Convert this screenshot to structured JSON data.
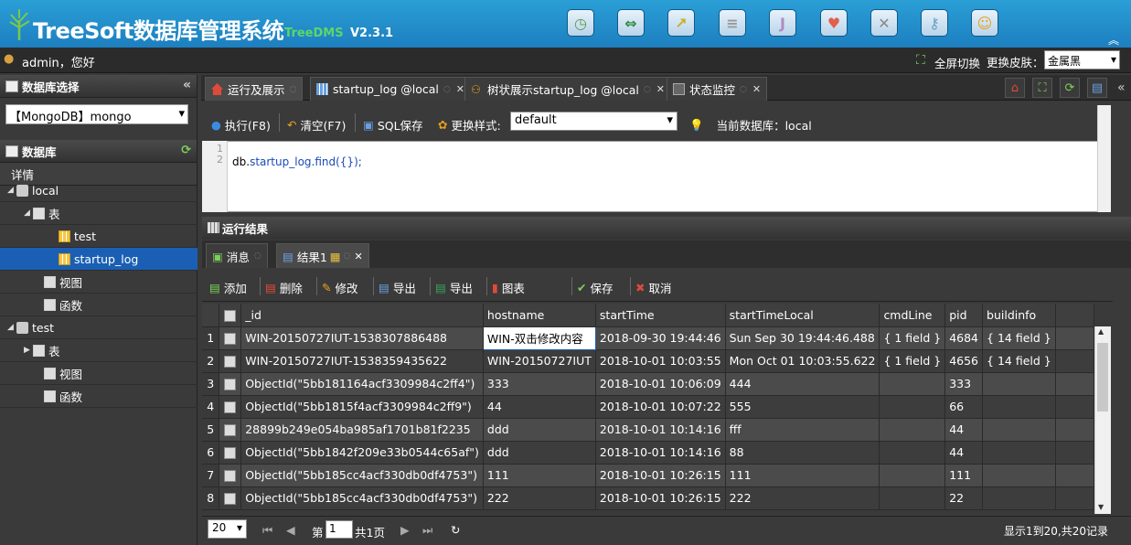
{
  "header": {
    "title": "TreeSoft数据库管理系统",
    "subtitle": "TreeDMS",
    "version": "V2.3.1",
    "toolbar_icons": [
      {
        "name": "clock-icon",
        "glyph": "◷",
        "color": "#5a9a4a"
      },
      {
        "name": "arrows-icon",
        "glyph": "⇔",
        "color": "#2d8a3c"
      },
      {
        "name": "chart-icon",
        "glyph": "↗",
        "color": "#c8b020"
      },
      {
        "name": "database-icon",
        "glyph": "≡",
        "color": "#999999"
      },
      {
        "name": "letter-j-icon",
        "glyph": "J",
        "color": "#b08ac0"
      },
      {
        "name": "heart-icon",
        "glyph": "♥",
        "color": "#e0604a"
      },
      {
        "name": "tools-icon",
        "glyph": "✕",
        "color": "#888888"
      },
      {
        "name": "key-icon",
        "glyph": "⚷",
        "color": "#6aa0c0"
      },
      {
        "name": "person-icon",
        "glyph": "☺",
        "color": "#e8a020"
      }
    ]
  },
  "userbar": {
    "greeting": "admin，您好",
    "fullscreen": "全屏切换",
    "skin_label": "更换皮肤：",
    "skin_value": "金属黑"
  },
  "sidebar": {
    "db_select_title": "数据库选择",
    "db_select_value": "【MongoDB】mongo",
    "db_title": "数据库",
    "detail_label": "详情",
    "tree": [
      {
        "label": "local",
        "arrow": "◢",
        "icon": "db",
        "indent": 8
      },
      {
        "label": "表",
        "arrow": "◢",
        "icon": "table",
        "indent": 26
      },
      {
        "label": "test",
        "arrow": "",
        "icon": "grid",
        "indent": 54
      },
      {
        "label": "startup_log",
        "arrow": "",
        "icon": "grid",
        "indent": 54,
        "selected": true
      },
      {
        "label": "视图",
        "arrow": "",
        "icon": "table",
        "indent": 38
      },
      {
        "label": "函数",
        "arrow": "",
        "icon": "table",
        "indent": 38
      },
      {
        "label": "test",
        "arrow": "◢",
        "icon": "db",
        "indent": 8
      },
      {
        "label": "表",
        "arrow": "▶",
        "icon": "table",
        "indent": 26
      },
      {
        "label": "视图",
        "arrow": "",
        "icon": "table",
        "indent": 38
      },
      {
        "label": "函数",
        "arrow": "",
        "icon": "table",
        "indent": 38
      }
    ]
  },
  "tabs": [
    {
      "label": "运行及展示",
      "icon": "home-icon"
    },
    {
      "label": "startup_log @local",
      "icon": "grid-icon"
    },
    {
      "label": "树状展示startup_log @local",
      "icon": "tree-icon"
    },
    {
      "label": "状态监控",
      "icon": "monitor-icon"
    }
  ],
  "sql_toolbar": {
    "execute": "执行(F8)",
    "clear": "清空(F7)",
    "save_sql": "SQL保存",
    "style_label": "更换样式:",
    "style_value": "default",
    "current_db": "当前数据库：local"
  },
  "editor": {
    "line_numbers": [
      "1",
      "2"
    ],
    "code_db": "db.",
    "code_rest": "startup_log.find({});"
  },
  "results": {
    "title": "运行结果",
    "tabs": [
      "消息",
      "结果1"
    ],
    "actions": [
      "添加",
      "删除",
      "修改",
      "导出",
      "导出",
      "图表",
      "保存",
      "取消"
    ],
    "columns": [
      "_id",
      "hostname",
      "startTime",
      "startTimeLocal",
      "cmdLine",
      "pid",
      "buildinfo"
    ],
    "rows": [
      [
        "WIN-20150727IUT-1538307886488",
        "WIN-双击修改内容",
        "2018-09-30 19:44:46",
        "Sun Sep 30 19:44:46.488",
        "{ 1 field }",
        "4684",
        "{ 14 field }"
      ],
      [
        "WIN-20150727IUT-1538359435622",
        "WIN-20150727IUT",
        "2018-10-01 10:03:55",
        "Mon Oct 01 10:03:55.622",
        "{ 1 field }",
        "4656",
        "{ 14 field }"
      ],
      [
        "ObjectId(\"5bb181164acf3309984c2ff4\")",
        "333",
        "2018-10-01 10:06:09",
        "444",
        "",
        "333",
        ""
      ],
      [
        "ObjectId(\"5bb1815f4acf3309984c2ff9\")",
        "44",
        "2018-10-01 10:07:22",
        "555",
        "",
        "66",
        ""
      ],
      [
        "28899b249e054ba985af1701b81f2235",
        "ddd",
        "2018-10-01 10:14:16",
        "fff",
        "",
        "44",
        ""
      ],
      [
        "ObjectId(\"5bb1842f209e33b0544c65af\")",
        "ddd",
        "2018-10-01 10:14:16",
        "88",
        "",
        "44",
        ""
      ],
      [
        "ObjectId(\"5bb185cc4acf330db0df4753\")",
        "111",
        "2018-10-01 10:26:15",
        "111",
        "",
        "111",
        ""
      ],
      [
        "ObjectId(\"5bb185cc4acf330db0df4753\")",
        "222",
        "2018-10-01 10:26:15",
        "222",
        "",
        "22",
        ""
      ]
    ]
  },
  "pager": {
    "page_size": "20",
    "page_prefix": "第",
    "page_value": "1",
    "page_suffix": "共1页",
    "summary": "显示1到20,共20记录"
  }
}
